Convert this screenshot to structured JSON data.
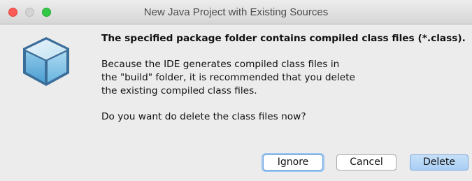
{
  "window": {
    "title": "New Java Project with Existing Sources"
  },
  "dialog": {
    "icon": "netbeans-cube-icon",
    "headline": "The specified package folder contains compiled class files (*.class).",
    "body_lines": [
      "Because the IDE generates compiled class files in",
      "the \"build\" folder, it is recommended that you delete",
      "the existing compiled class files."
    ],
    "question": "Do you want do delete the class files now?"
  },
  "buttons": {
    "ignore": "Ignore",
    "cancel": "Cancel",
    "delete": "Delete"
  },
  "colors": {
    "close": "#fc5b57",
    "minimize": "#d3d3d3",
    "zoom": "#33c748",
    "default_button": "#a9cff5",
    "focus_ring": "#9cc6f0"
  }
}
